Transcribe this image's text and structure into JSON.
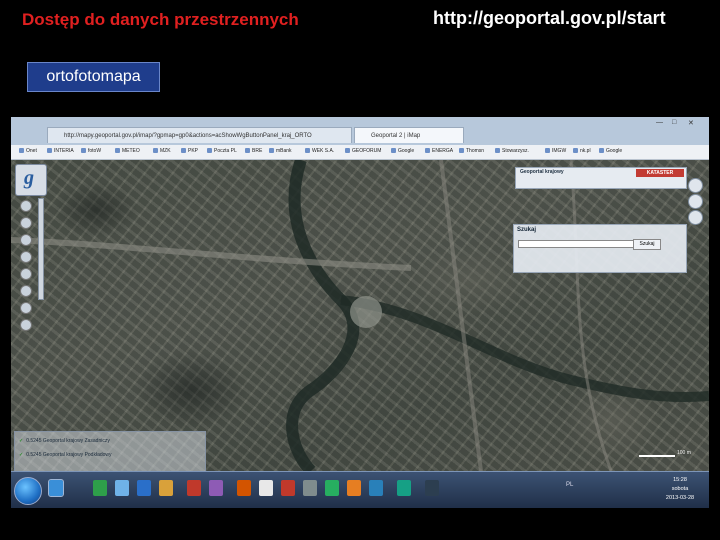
{
  "slide": {
    "title": "Dostęp do danych przestrzennych",
    "url": "http://geoportal.gov.pl/start",
    "layer_label": "ortofotomapa"
  },
  "browser": {
    "address": "http://mapy.geoportal.gov.pl/imap/?gpmap=gp0&actions=acShowWgButtonPanel_kraj_ORTO",
    "tab_title": "Geoportal 2 | iMap",
    "bookmarks": [
      "Onet",
      "INTERIA",
      "fotoW",
      "METEO",
      "MZK",
      "PKP",
      "Poczta PL",
      "BRE",
      "mBank",
      "WEK S.A.",
      "GEOFORUM",
      "Google",
      "ENERGA",
      "Thomsn",
      "Stowarzysz.",
      "IMGW",
      "nk.pl",
      "Google"
    ]
  },
  "geoportal": {
    "panel_title": "Geoportal krajowy",
    "panel_button": "KATASTER",
    "search_label": "Szukaj",
    "search_placeholder": "",
    "search_button": "Szukaj",
    "layers": [
      "0.5245   Geoportal krajowy Zasadniczy",
      "0.5245   Geoportal krajowy Podkładowy"
    ],
    "scale": "100 m"
  },
  "taskbar": {
    "language": "PL",
    "time": "15:28",
    "day": "sobota",
    "date": "2013-03-28"
  },
  "colors": {
    "title_red": "#e02020",
    "layer_box": "#1f3d8c",
    "taskbar": "#1f2e47"
  }
}
